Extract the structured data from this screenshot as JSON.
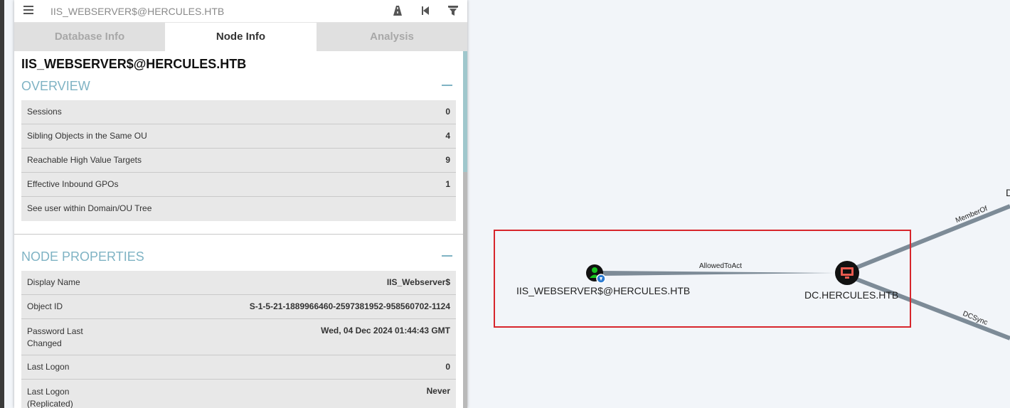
{
  "search": {
    "value": "IIS_WEBSERVER$@HERCULES.HTB"
  },
  "tabs": [
    {
      "label": "Database Info",
      "active": false
    },
    {
      "label": "Node Info",
      "active": true
    },
    {
      "label": "Analysis",
      "active": false
    }
  ],
  "node": {
    "title": "IIS_WEBSERVER$@HERCULES.HTB"
  },
  "overview": {
    "heading": "OVERVIEW",
    "rows": [
      {
        "label": "Sessions",
        "value": "0"
      },
      {
        "label": "Sibling Objects in the Same OU",
        "value": "4"
      },
      {
        "label": "Reachable High Value Targets",
        "value": "9"
      },
      {
        "label": "Effective Inbound GPOs",
        "value": "1"
      },
      {
        "label": "See user within Domain/OU Tree",
        "value": ""
      }
    ]
  },
  "properties": {
    "heading": "NODE PROPERTIES",
    "rows": [
      {
        "label": "Display Name",
        "value": "IIS_Webserver$"
      },
      {
        "label": "Object ID",
        "value": "S-1-5-21-1889966460-2597381952-958560702-1124"
      },
      {
        "label": "Password Last Changed",
        "value": "Wed, 04 Dec 2024 01:44:43 GMT"
      },
      {
        "label": "Last Logon",
        "value": "0"
      },
      {
        "label": "Last Logon (Replicated)",
        "value": "Never"
      }
    ]
  },
  "graph": {
    "source_node": "IIS_WEBSERVER$@HERCULES.HTB",
    "target_node": "DC.HERCULES.HTB",
    "edge_main": "AllowedToAct",
    "edge_memberof": "MemberOf",
    "edge_dcsync": "DCSync",
    "offscreen_partial_label": "D"
  },
  "colors": {
    "highlight_box": "#d7262c",
    "arrow": "#e8262b",
    "user_node": "#16c21f",
    "computer_node": "#e85a4f",
    "edge": "#7d8b97",
    "section_heading": "#7fb3c4"
  },
  "icons": {
    "menu": "hamburger-icon",
    "pathfinding": "road-icon",
    "back": "skip-back-icon",
    "filter": "filter-icon"
  }
}
